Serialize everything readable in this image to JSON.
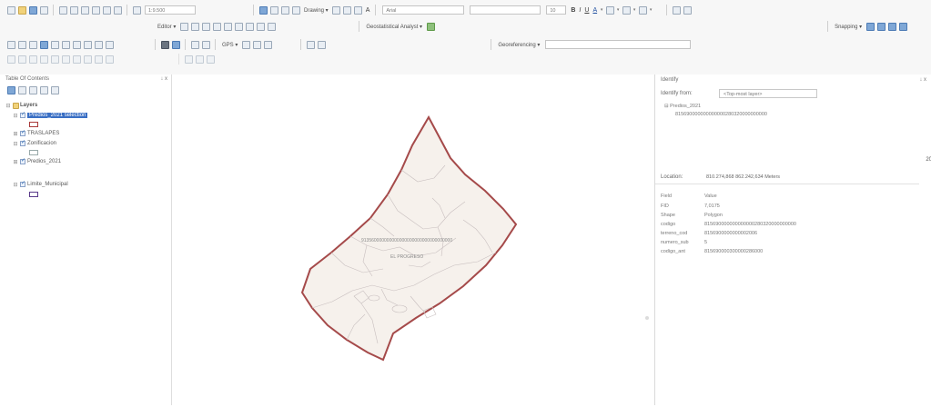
{
  "toolbars": {
    "scale": "1:9.500",
    "drawing": "Drawing ▾",
    "font_combo": "Arial",
    "font_size": "10",
    "bold": "B",
    "italic": "I",
    "underline": "U",
    "text_a": "A",
    "editor": "Editor ▾",
    "geostatistical": "Geostatistical Analyst ▾",
    "gps": "GPS ▾",
    "georeferencing": "Georeferencing ▾",
    "snapping": "Snapping ▾"
  },
  "toc": {
    "title": "Table Of Contents",
    "pin": "↓ x",
    "layers_root": "Layers",
    "layers": [
      {
        "label": "Predios_2021 selection"
      },
      {
        "label": "TRASLAPES"
      },
      {
        "label": "Zonificacion"
      },
      {
        "label": "Predios_2021"
      },
      {
        "label": "Limite_Municipal"
      }
    ]
  },
  "map": {
    "parcel_id_label": "913560000000000000000000000000000000",
    "parcel_name_label": "EL PROGRESO"
  },
  "identify": {
    "title": "Identify",
    "pin": "↓ x",
    "identify_from_label": "Identify from:",
    "identify_from_value": "<Top-most layer>",
    "tree_layer": "Predios_2021",
    "tree_feature": "815690000000000000280320000000000",
    "location_label": "Location:",
    "location_value": "810.274,868  862.242,634 Meters",
    "right_edge_num": "20",
    "field_header": "Field",
    "value_header": "Value",
    "fields": [
      {
        "field": "FID",
        "value": "7,0175"
      },
      {
        "field": "Shape",
        "value": "Polygon"
      },
      {
        "field": "codigo",
        "value": "815690000000000000280320000000000"
      },
      {
        "field": "terreno_cod",
        "value": "8156900000000002006"
      },
      {
        "field": "numero_sub",
        "value": "5"
      },
      {
        "field": "codigo_ant",
        "value": "815690000300000286000"
      }
    ]
  }
}
